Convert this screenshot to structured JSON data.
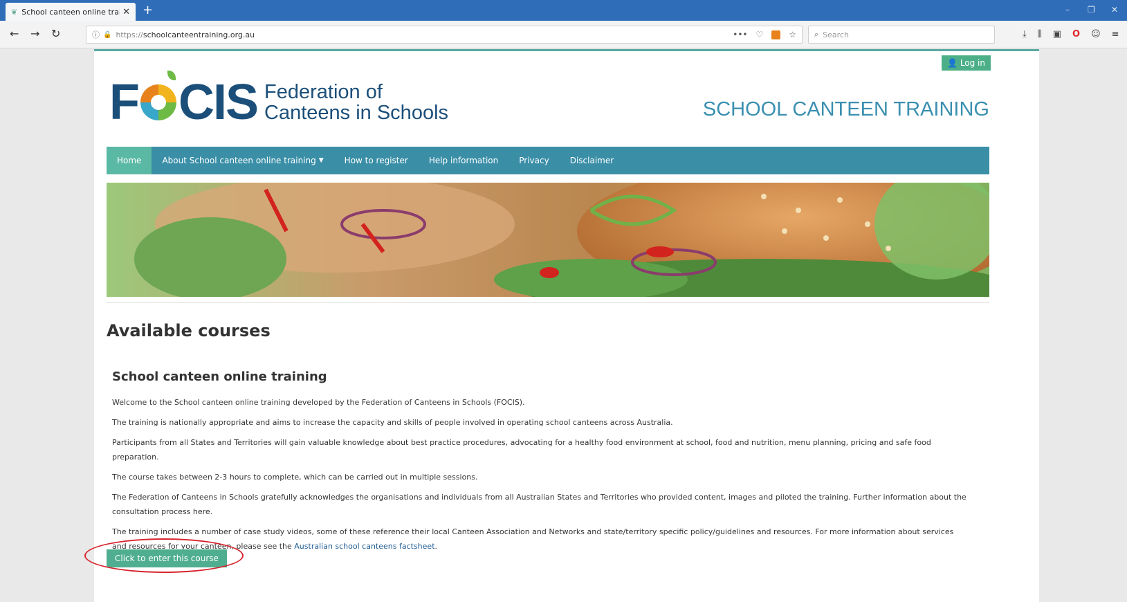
{
  "browser": {
    "tab_title": "School canteen online training",
    "new_tab": "+",
    "url_host": "schoolcanteentraining.org.au",
    "url_protocol": "https://",
    "search_placeholder": "Search",
    "menu_dots": "•••",
    "minimize": "–",
    "restore": "❐",
    "close": "✕"
  },
  "site": {
    "login_label": "Log in",
    "logo_left": "F",
    "logo_right": "CIS",
    "org_line1": "Federation of",
    "org_line2": "Canteens in Schools",
    "brand_title": "SCHOOL CANTEEN TRAINING",
    "nav": [
      {
        "label": "Home"
      },
      {
        "label": "About School canteen online training"
      },
      {
        "label": "How to register"
      },
      {
        "label": "Help information"
      },
      {
        "label": "Privacy"
      },
      {
        "label": "Disclaimer"
      }
    ]
  },
  "content": {
    "heading": "Available courses",
    "course_title": "School canteen online training",
    "paragraphs": [
      "Welcome to the School canteen online training developed by the Federation of Canteens in Schools (FOCIS).",
      "The training is nationally appropriate and aims to increase the capacity and skills of people involved in operating school canteens across Australia.",
      "Participants from all States and Territories will gain valuable knowledge about best practice procedures, advocating for a healthy food environment at school, food and nutrition, menu planning, pricing and safe food preparation.",
      "The course takes between 2-3 hours to complete, which can be carried out in multiple sessions.",
      "The Federation of Canteens in Schools gratefully acknowledges the organisations and individuals from all Australian States and Territories who provided content, images and piloted the training. Further information about the consultation process here."
    ],
    "last_para_text": "The training includes a number of case study videos, some of these reference their local Canteen Association and Networks and state/territory specific policy/guidelines and resources. For more information about services and resources for your canteen, please see the",
    "factsheet_link": "Australian school canteens factsheet",
    "enter_button": "Click to enter this course"
  },
  "colors": {
    "accent_teal": "#3a8fa7",
    "button_green": "#4fae8f",
    "annotation_red": "#d7262e"
  }
}
